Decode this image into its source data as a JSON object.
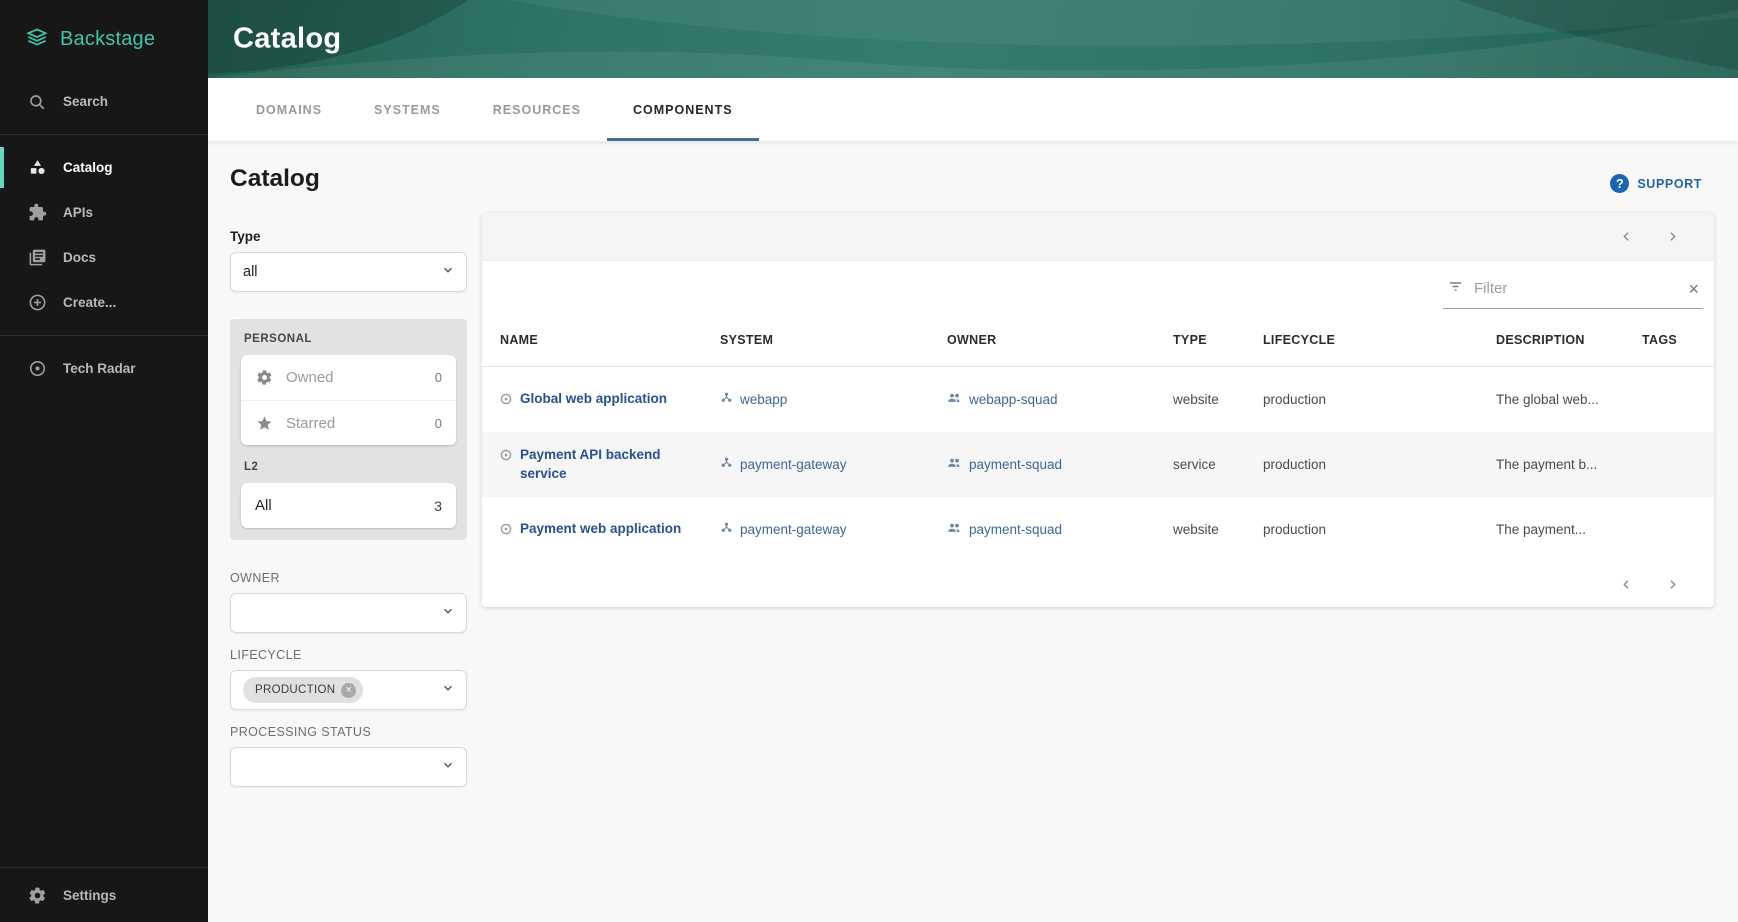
{
  "colors": {
    "sidebar_bg": "#171717",
    "accent_teal": "#3ec5ab",
    "active_bar_teal": "#67d6bd",
    "header_green_base": "#2f7b6b",
    "tab_underline_blue": "#456e91",
    "link_name_blue": "#27518f",
    "link_ref_blue": "#3d6796",
    "support_blue": "#2364ad",
    "content_bg": "#f8f8f8"
  },
  "sidebar": {
    "logo": "Backstage",
    "items": [
      {
        "label": "Search",
        "icon": "search-icon"
      },
      {
        "label": "Catalog",
        "icon": "category-icon",
        "active": true
      },
      {
        "label": "APIs",
        "icon": "puzzle-icon"
      },
      {
        "label": "Docs",
        "icon": "docs-icon"
      },
      {
        "label": "Create...",
        "icon": "plus-circle-icon"
      },
      {
        "label": "Tech Radar",
        "icon": "radar-icon"
      }
    ],
    "settings_label": "Settings"
  },
  "header": {
    "title": "Catalog"
  },
  "tabs": [
    {
      "label": "DOMAINS",
      "active": false
    },
    {
      "label": "SYSTEMS",
      "active": false
    },
    {
      "label": "RESOURCES",
      "active": false
    },
    {
      "label": "COMPONENTS",
      "active": true
    }
  ],
  "page": {
    "title": "Catalog",
    "support_label": "SUPPORT"
  },
  "filters": {
    "type": {
      "label": "Type",
      "value": "all"
    },
    "personal": {
      "label": "PERSONAL",
      "items": [
        {
          "label": "Owned",
          "count": 0,
          "icon": "gear-icon"
        },
        {
          "label": "Starred",
          "count": 0,
          "icon": "star-icon"
        }
      ]
    },
    "l2": {
      "label": "L2",
      "items": [
        {
          "label": "All",
          "count": 3
        }
      ]
    },
    "owner": {
      "label": "OWNER",
      "value": ""
    },
    "lifecycle": {
      "label": "LIFECYCLE",
      "chip": "PRODUCTION"
    },
    "processing_status": {
      "label": "PROCESSING STATUS",
      "value": ""
    }
  },
  "table": {
    "filter_placeholder": "Filter",
    "columns": [
      "NAME",
      "SYSTEM",
      "OWNER",
      "TYPE",
      "LIFECYCLE",
      "DESCRIPTION",
      "TAGS"
    ],
    "rows": [
      {
        "name": "Global web application",
        "system": "webapp",
        "owner": "webapp-squad",
        "type": "website",
        "lifecycle": "production",
        "description": "The global web...",
        "tags": ""
      },
      {
        "name": "Payment API backend service",
        "system": "payment-gateway",
        "owner": "payment-squad",
        "type": "service",
        "lifecycle": "production",
        "description": "The payment b...",
        "tags": ""
      },
      {
        "name": "Payment web application",
        "system": "payment-gateway",
        "owner": "payment-squad",
        "type": "website",
        "lifecycle": "production",
        "description": "The payment...",
        "tags": ""
      }
    ]
  }
}
